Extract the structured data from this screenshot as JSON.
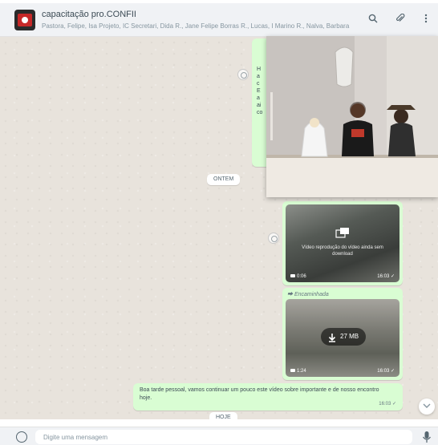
{
  "page_title": "",
  "header": {
    "chat_name": "capacitação pro.CONFII",
    "members": "Pastora, Felipe, Isa Projeto, IC Secretari, Dida R., Jane Felipe Borras R., Lucas, I Marino R., Nalva, Barbara",
    "icons": [
      "search-icon",
      "attach-icon",
      "menu-icon"
    ]
  },
  "messages": {
    "top_bubble_lines": [
      "H",
      "a",
      "c",
      "",
      "E",
      "a",
      "ai",
      "",
      "co"
    ],
    "date_chip_1": "ONTEM",
    "video_1": {
      "icon": "download-video-icon",
      "caption": "Vídeo reprodução do vídeo ainda sem download",
      "duration": "0:06",
      "time": "16:03 ✓"
    },
    "forwarded_label": "⮕ Encaminhada",
    "video_2": {
      "icon": "download-icon",
      "size": "27 MB",
      "duration": "1:24",
      "time": "16:03 ✓"
    },
    "text_message": "Boa tarde pessoal, vamos continuar um pouco este vídeo sobre importante e de nosso encontro hoje.",
    "text_time": "16:03 ✓",
    "date_chip_2": "HOJE"
  },
  "composer": {
    "placeholder": "Digite uma mensagem"
  },
  "colors": {
    "header_bg": "#f0f2f5",
    "chat_bg": "#e8e3dc",
    "outgoing_bubble": "#d9fdd3",
    "accent": "#00a884"
  }
}
